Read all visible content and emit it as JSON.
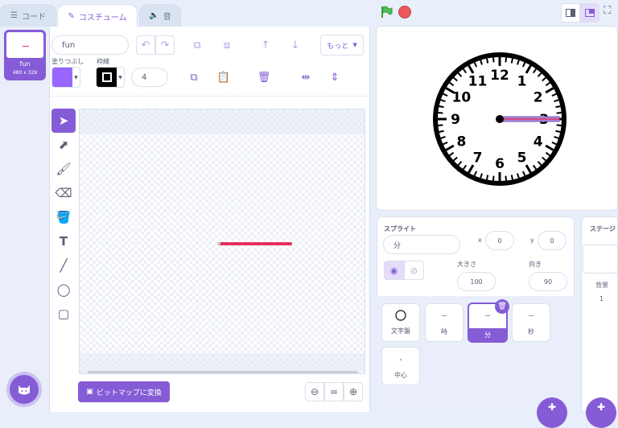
{
  "tabs": [
    {
      "label": "コード",
      "icon": "code-blocks-icon"
    },
    {
      "label": "コスチューム",
      "icon": "paintbrush-icon"
    },
    {
      "label": "音",
      "icon": "speaker-icon"
    }
  ],
  "costume": {
    "index": "1",
    "name": "fun",
    "size": "480 x 329"
  },
  "editor": {
    "costume_name": "fun",
    "fill_label": "塗りつぶし",
    "outline_label": "枠線",
    "outline_width": "4",
    "more_label": "もっと",
    "convert_label": "ビットマップに変換",
    "fill_color": "#9966ff",
    "line_color": "#e6305e"
  },
  "stage_clock": {
    "numbers": [
      "12",
      "1",
      "2",
      "3",
      "4",
      "5",
      "6",
      "7",
      "8",
      "9",
      "10",
      "11"
    ]
  },
  "sprite_panel": {
    "label": "スプライト",
    "name": "分",
    "x_label": "x",
    "x": "0",
    "y_label": "y",
    "y": "0",
    "size_label": "大きさ",
    "size": "100",
    "direction_label": "向き",
    "direction": "90"
  },
  "sprites": [
    {
      "name": "文字盤"
    },
    {
      "name": "時"
    },
    {
      "name": "分"
    },
    {
      "name": "秒"
    },
    {
      "name": "中心"
    }
  ],
  "stage_panel": {
    "label": "ステージ",
    "backdrop_label": "背景",
    "backdrop_count": "1"
  },
  "colors": {
    "accent": "#855cd6",
    "green_flag": "#4cbf56",
    "stop": "#ec5959"
  }
}
